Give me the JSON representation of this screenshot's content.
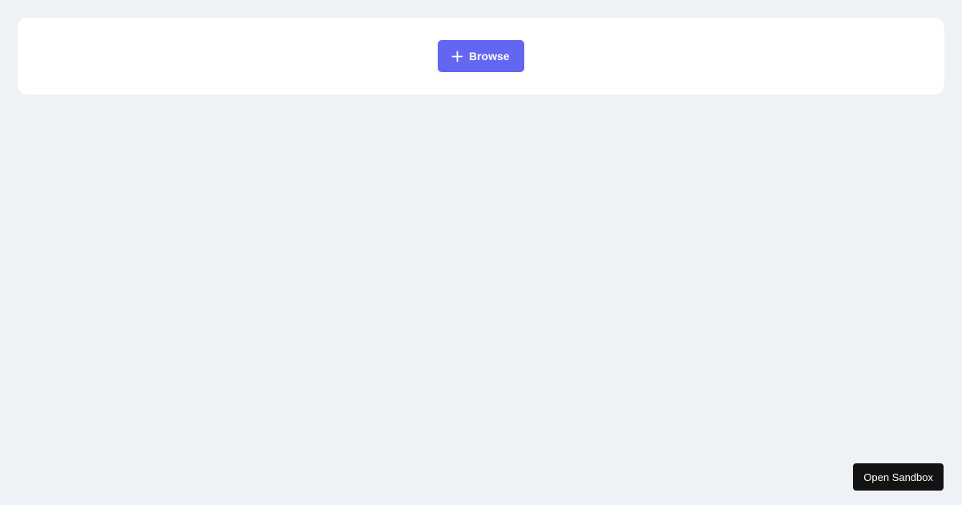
{
  "toolbar": {
    "browse_label": "Browse",
    "browse_icon": "plus-icon"
  },
  "footer": {
    "sandbox_label": "Open Sandbox"
  },
  "colors": {
    "background": "#eef1f6",
    "card": "#ffffff",
    "accent": "#6366f1",
    "sandbox_button": "#131313"
  }
}
